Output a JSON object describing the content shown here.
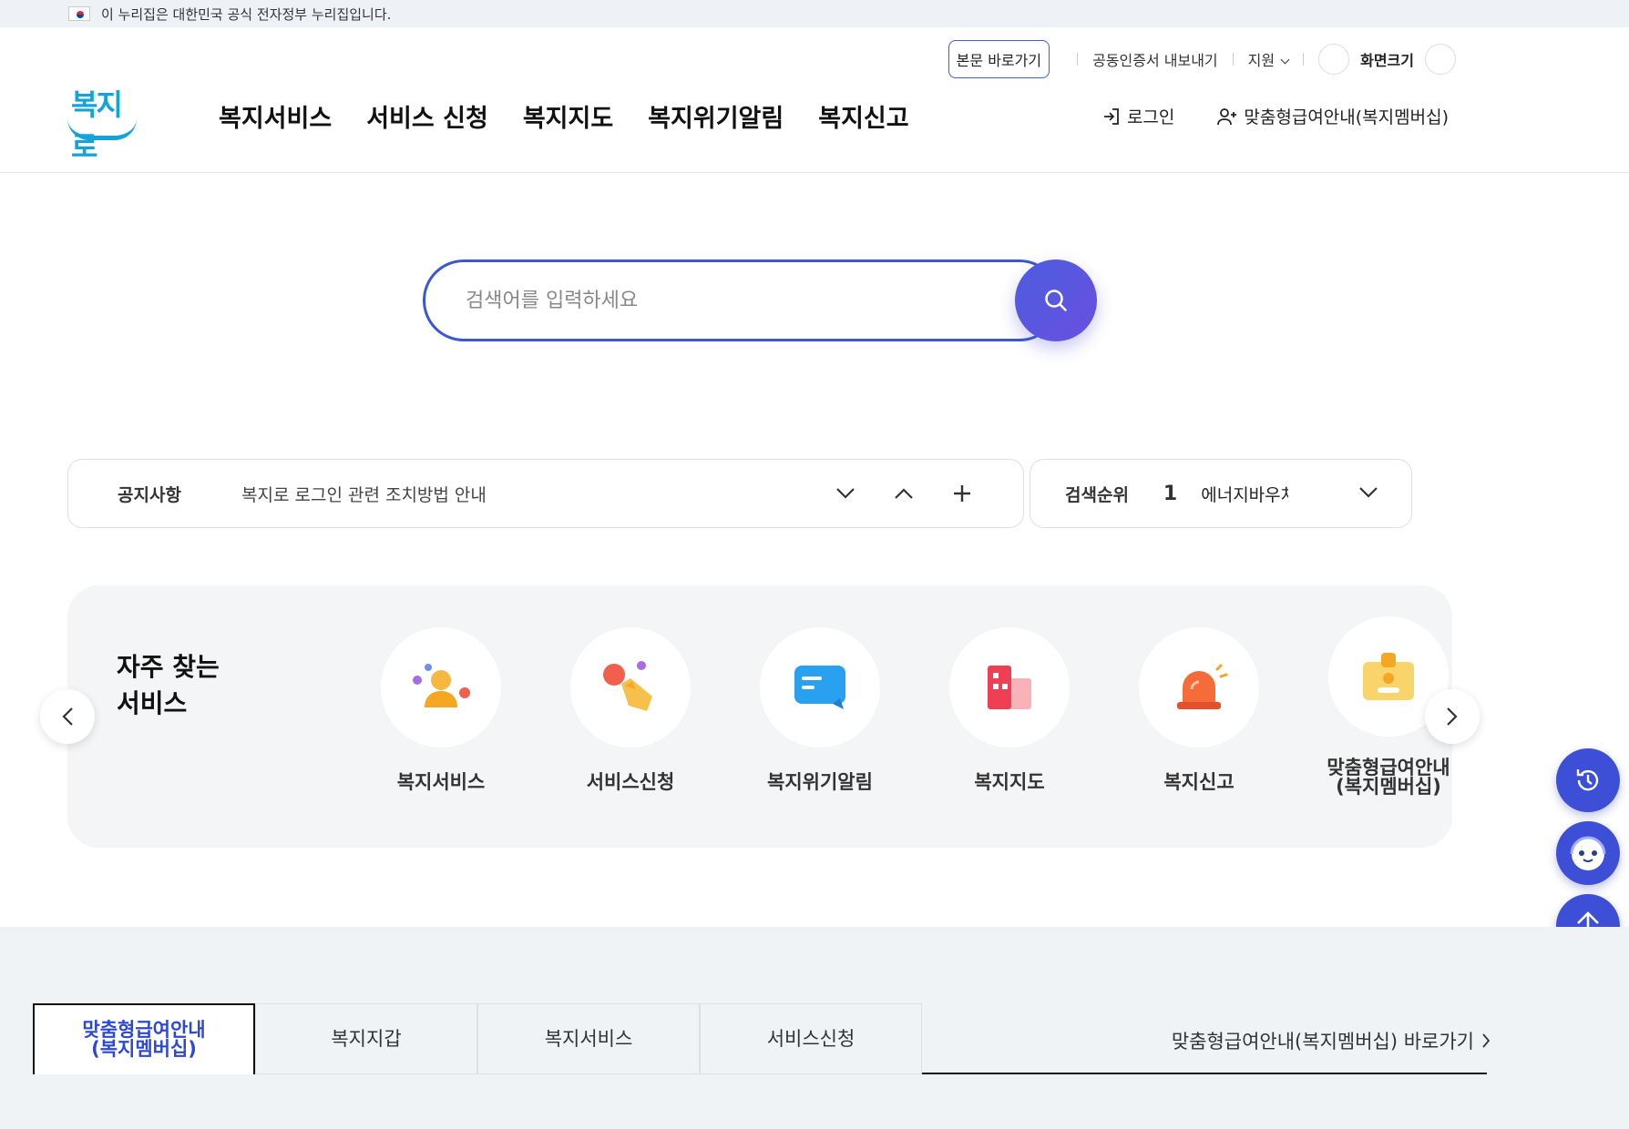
{
  "gov_banner": {
    "text": "이 누리집은 대한민국 공식 전자정부 누리집입니다."
  },
  "utility": {
    "skip": "본문 바로가기",
    "cert": "공동인증서 내보내기",
    "support": "지원",
    "font_size": "화면크기"
  },
  "logo": {
    "text": "복지로"
  },
  "gnb": [
    "복지서비스",
    "서비스 신청",
    "복지지도",
    "복지위기알림",
    "복지신고"
  ],
  "auth": {
    "login": "로그인",
    "membership": "맞춤형급여안내(복지멤버십)"
  },
  "search": {
    "placeholder": "검색어를 입력하세요"
  },
  "notice": {
    "label": "공지사항",
    "text": "복지로 로그인 관련 조치방법 안내"
  },
  "rank": {
    "label": "검색순위",
    "num": "1",
    "keyword": "에너지바우처"
  },
  "frequent": {
    "title_line1": "자주 찾는",
    "title_line2": "서비스",
    "items": [
      {
        "label": "복지서비스",
        "icon": "people-icon"
      },
      {
        "label": "서비스신청",
        "icon": "hand-click-icon"
      },
      {
        "label": "복지위기알림",
        "icon": "message-icon"
      },
      {
        "label": "복지지도",
        "icon": "building-icon"
      },
      {
        "label": "복지신고",
        "icon": "siren-icon"
      },
      {
        "label_line1": "맞춤형급여안내",
        "label_line2": "(복지멤버십)",
        "icon": "id-card-icon"
      }
    ]
  },
  "tabs": [
    {
      "line1": "맞춤형급여안내",
      "line2": "(복지멤버십)"
    },
    {
      "line1": "복지지갑"
    },
    {
      "line1": "복지서비스"
    },
    {
      "line1": "서비스신청"
    }
  ],
  "shortcut": "맞춤형급여안내(복지멤버십) 바로가기",
  "colors": {
    "accent": "#3b56d6",
    "logo": "#14a3d8",
    "float": "#3d4fd6"
  }
}
